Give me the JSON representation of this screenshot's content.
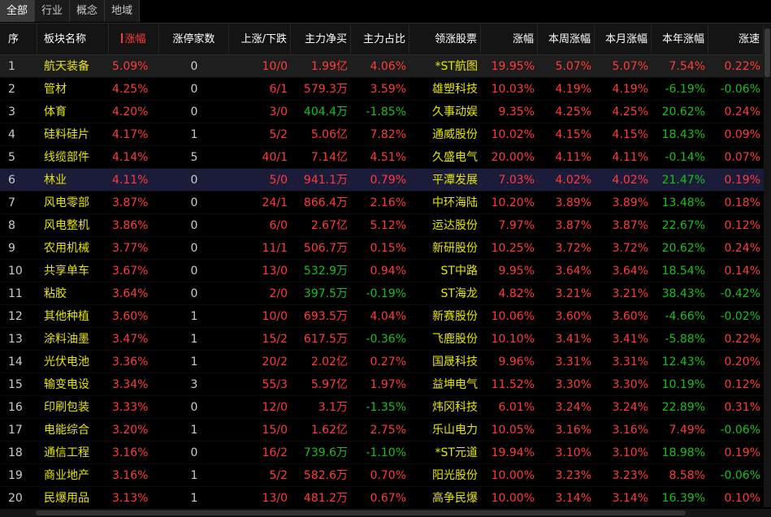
{
  "tabs": [
    {
      "label": "全部",
      "active": true
    },
    {
      "label": "行业",
      "active": false
    },
    {
      "label": "概念",
      "active": false
    },
    {
      "label": "地域",
      "active": false
    }
  ],
  "columns": {
    "seq": "序",
    "name": "板块名称",
    "pct": "涨幅",
    "limit_count": "涨停家数",
    "up_down": "上涨/下跌",
    "net_inflow": "主力净买",
    "main_ratio": "主力占比",
    "leader": "领涨股票",
    "leader_chg": "涨幅",
    "week_chg": "本周涨幅",
    "month_chg": "本月涨幅",
    "year_chg": "本年涨幅",
    "speed": "涨速"
  },
  "colors": {
    "up": "#ff3b3b",
    "down": "#18c018",
    "name": "#e6e600"
  },
  "rows": [
    {
      "seq": "1",
      "name": "航天装备",
      "pct": "5.09%",
      "limit": "0",
      "ud": "10/0",
      "net": "1.99亿",
      "ratio": "4.06%",
      "leader": "*ST航图",
      "lchg": "19.95%",
      "week": "5.07%",
      "month": "5.07%",
      "year": "7.54%",
      "speed": "0.22%",
      "net_dir": "red",
      "ratio_dir": "red",
      "year_dir": "red",
      "speed_dir": "red"
    },
    {
      "seq": "2",
      "name": "管材",
      "pct": "4.25%",
      "limit": "0",
      "ud": "6/1",
      "net": "579.3万",
      "ratio": "3.59%",
      "leader": "雄塑科技",
      "lchg": "10.03%",
      "week": "4.19%",
      "month": "4.19%",
      "year": "-6.19%",
      "speed": "-0.06%",
      "net_dir": "red",
      "ratio_dir": "red",
      "year_dir": "green",
      "speed_dir": "green"
    },
    {
      "seq": "3",
      "name": "体育",
      "pct": "4.20%",
      "limit": "0",
      "ud": "3/0",
      "net": "404.4万",
      "ratio": "-1.85%",
      "leader": "久事动娱",
      "lchg": "9.35%",
      "week": "4.25%",
      "month": "4.25%",
      "year": "20.62%",
      "speed": "0.24%",
      "net_dir": "green",
      "ratio_dir": "green",
      "year_dir": "green",
      "speed_dir": "red"
    },
    {
      "seq": "4",
      "name": "硅料硅片",
      "pct": "4.17%",
      "limit": "1",
      "ud": "5/2",
      "net": "5.06亿",
      "ratio": "7.82%",
      "leader": "通威股份",
      "lchg": "10.02%",
      "week": "4.15%",
      "month": "4.15%",
      "year": "18.43%",
      "speed": "0.09%",
      "net_dir": "red",
      "ratio_dir": "red",
      "year_dir": "green",
      "speed_dir": "red"
    },
    {
      "seq": "5",
      "name": "线缆部件",
      "pct": "4.14%",
      "limit": "5",
      "ud": "40/1",
      "net": "7.14亿",
      "ratio": "4.51%",
      "leader": "久盛电气",
      "lchg": "20.00%",
      "week": "4.11%",
      "month": "4.11%",
      "year": "-0.14%",
      "speed": "0.07%",
      "net_dir": "red",
      "ratio_dir": "red",
      "year_dir": "green",
      "speed_dir": "red"
    },
    {
      "seq": "6",
      "name": "林业",
      "pct": "4.11%",
      "limit": "0",
      "ud": "5/0",
      "net": "941.1万",
      "ratio": "0.79%",
      "leader": "平潭发展",
      "lchg": "7.03%",
      "week": "4.02%",
      "month": "4.02%",
      "year": "21.47%",
      "speed": "0.19%",
      "net_dir": "red",
      "ratio_dir": "red",
      "year_dir": "green",
      "speed_dir": "red"
    },
    {
      "seq": "7",
      "name": "风电零部",
      "pct": "3.87%",
      "limit": "0",
      "ud": "24/1",
      "net": "866.4万",
      "ratio": "2.16%",
      "leader": "中环海陆",
      "lchg": "10.20%",
      "week": "3.89%",
      "month": "3.89%",
      "year": "13.48%",
      "speed": "0.18%",
      "net_dir": "red",
      "ratio_dir": "red",
      "year_dir": "green",
      "speed_dir": "red"
    },
    {
      "seq": "8",
      "name": "风电整机",
      "pct": "3.86%",
      "limit": "0",
      "ud": "6/0",
      "net": "2.67亿",
      "ratio": "5.12%",
      "leader": "运达股份",
      "lchg": "7.97%",
      "week": "3.87%",
      "month": "3.87%",
      "year": "22.67%",
      "speed": "0.12%",
      "net_dir": "red",
      "ratio_dir": "red",
      "year_dir": "green",
      "speed_dir": "red"
    },
    {
      "seq": "9",
      "name": "农用机械",
      "pct": "3.77%",
      "limit": "0",
      "ud": "11/1",
      "net": "506.7万",
      "ratio": "0.15%",
      "leader": "新研股份",
      "lchg": "10.25%",
      "week": "3.72%",
      "month": "3.72%",
      "year": "20.62%",
      "speed": "0.24%",
      "net_dir": "red",
      "ratio_dir": "red",
      "year_dir": "green",
      "speed_dir": "red"
    },
    {
      "seq": "10",
      "name": "共享单车",
      "pct": "3.67%",
      "limit": "0",
      "ud": "13/0",
      "net": "532.9万",
      "ratio": "0.94%",
      "leader": "ST中路",
      "lchg": "9.95%",
      "week": "3.64%",
      "month": "3.64%",
      "year": "18.54%",
      "speed": "0.14%",
      "net_dir": "green",
      "ratio_dir": "red",
      "year_dir": "green",
      "speed_dir": "red"
    },
    {
      "seq": "11",
      "name": "粘胶",
      "pct": "3.64%",
      "limit": "0",
      "ud": "2/0",
      "net": "397.5万",
      "ratio": "-0.19%",
      "leader": "ST海龙",
      "lchg": "4.82%",
      "week": "3.21%",
      "month": "3.21%",
      "year": "38.43%",
      "speed": "-0.42%",
      "net_dir": "green",
      "ratio_dir": "green",
      "year_dir": "green",
      "speed_dir": "green"
    },
    {
      "seq": "12",
      "name": "其他种植",
      "pct": "3.60%",
      "limit": "1",
      "ud": "10/0",
      "net": "693.5万",
      "ratio": "4.04%",
      "leader": "新赛股份",
      "lchg": "10.06%",
      "week": "3.60%",
      "month": "3.60%",
      "year": "-4.66%",
      "speed": "-0.02%",
      "net_dir": "red",
      "ratio_dir": "red",
      "year_dir": "green",
      "speed_dir": "green"
    },
    {
      "seq": "13",
      "name": "涂料油墨",
      "pct": "3.47%",
      "limit": "1",
      "ud": "15/2",
      "net": "617.5万",
      "ratio": "-0.36%",
      "leader": "飞鹿股份",
      "lchg": "10.10%",
      "week": "3.41%",
      "month": "3.41%",
      "year": "-5.88%",
      "speed": "0.22%",
      "net_dir": "red",
      "ratio_dir": "green",
      "year_dir": "green",
      "speed_dir": "red"
    },
    {
      "seq": "14",
      "name": "光伏电池",
      "pct": "3.36%",
      "limit": "1",
      "ud": "20/2",
      "net": "2.02亿",
      "ratio": "0.27%",
      "leader": "国晟科技",
      "lchg": "9.96%",
      "week": "3.31%",
      "month": "3.31%",
      "year": "12.43%",
      "speed": "0.20%",
      "net_dir": "red",
      "ratio_dir": "red",
      "year_dir": "green",
      "speed_dir": "red"
    },
    {
      "seq": "15",
      "name": "输变电设",
      "pct": "3.34%",
      "limit": "3",
      "ud": "55/3",
      "net": "5.97亿",
      "ratio": "1.97%",
      "leader": "益坤电气",
      "lchg": "11.52%",
      "week": "3.30%",
      "month": "3.30%",
      "year": "10.19%",
      "speed": "0.12%",
      "net_dir": "red",
      "ratio_dir": "red",
      "year_dir": "green",
      "speed_dir": "red"
    },
    {
      "seq": "16",
      "name": "印刷包装",
      "pct": "3.33%",
      "limit": "0",
      "ud": "12/0",
      "net": "3.1万",
      "ratio": "-1.35%",
      "leader": "炜冈科技",
      "lchg": "6.01%",
      "week": "3.24%",
      "month": "3.24%",
      "year": "22.89%",
      "speed": "0.31%",
      "net_dir": "red",
      "ratio_dir": "green",
      "year_dir": "green",
      "speed_dir": "red"
    },
    {
      "seq": "17",
      "name": "电能综合",
      "pct": "3.20%",
      "limit": "1",
      "ud": "15/0",
      "net": "1.62亿",
      "ratio": "2.75%",
      "leader": "乐山电力",
      "lchg": "10.05%",
      "week": "3.16%",
      "month": "3.16%",
      "year": "7.49%",
      "speed": "-0.06%",
      "net_dir": "red",
      "ratio_dir": "red",
      "year_dir": "red",
      "speed_dir": "green"
    },
    {
      "seq": "18",
      "name": "通信工程",
      "pct": "3.16%",
      "limit": "0",
      "ud": "16/2",
      "net": "739.6万",
      "ratio": "-1.10%",
      "leader": "*ST元道",
      "lchg": "19.94%",
      "week": "3.10%",
      "month": "3.10%",
      "year": "18.98%",
      "speed": "0.19%",
      "net_dir": "green",
      "ratio_dir": "green",
      "year_dir": "green",
      "speed_dir": "red"
    },
    {
      "seq": "19",
      "name": "商业地产",
      "pct": "3.16%",
      "limit": "1",
      "ud": "5/2",
      "net": "582.6万",
      "ratio": "0.70%",
      "leader": "阳光股份",
      "lchg": "10.00%",
      "week": "3.23%",
      "month": "3.23%",
      "year": "8.58%",
      "speed": "-0.06%",
      "net_dir": "red",
      "ratio_dir": "red",
      "year_dir": "red",
      "speed_dir": "green"
    },
    {
      "seq": "20",
      "name": "民爆用品",
      "pct": "3.13%",
      "limit": "1",
      "ud": "13/0",
      "net": "481.2万",
      "ratio": "0.67%",
      "leader": "高争民爆",
      "lchg": "10.00%",
      "week": "3.14%",
      "month": "3.14%",
      "year": "16.39%",
      "speed": "0.10%",
      "net_dir": "red",
      "ratio_dir": "red",
      "year_dir": "green",
      "speed_dir": "red"
    }
  ]
}
